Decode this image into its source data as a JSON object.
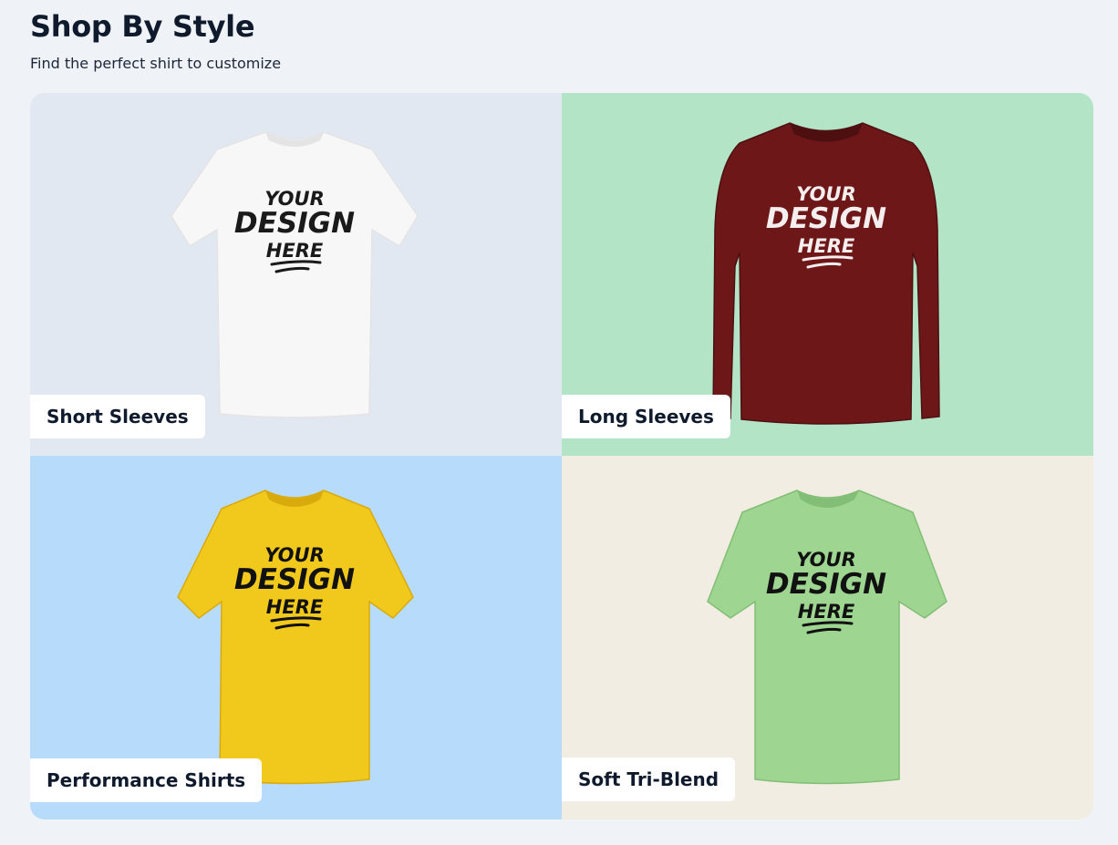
{
  "header": {
    "title": "Shop By Style",
    "subtitle": "Find the perfect shirt to customize"
  },
  "styles": [
    {
      "label": "Short Sleeves",
      "background": "#e1e8f1",
      "shirt_color": "#f7f7f7",
      "shirt_shade": "#e4e4e4",
      "print_color": "#1a1a1a",
      "sleeve": "short",
      "print_lines": [
        "YOUR",
        "DESIGN",
        "HERE"
      ]
    },
    {
      "label": "Long Sleeves",
      "background": "#b2e4c5",
      "shirt_color": "#6e1719",
      "shirt_shade": "#4e0f11",
      "print_color": "#f4eeee",
      "sleeve": "long",
      "print_lines": [
        "YOUR",
        "DESIGN",
        "HERE"
      ]
    },
    {
      "label": "Performance Shirts",
      "background": "#b7dbfa",
      "shirt_color": "#f1c81c",
      "shirt_shade": "#d9aa0c",
      "print_color": "#111111",
      "sleeve": "short",
      "print_lines": [
        "YOUR",
        "DESIGN",
        "HERE"
      ]
    },
    {
      "label": "Soft Tri-Blend",
      "background": "#f1ede2",
      "shirt_color": "#9ed591",
      "shirt_shade": "#82be76",
      "print_color": "#111111",
      "sleeve": "short",
      "print_lines": [
        "YOUR",
        "DESIGN",
        "HERE"
      ]
    }
  ]
}
